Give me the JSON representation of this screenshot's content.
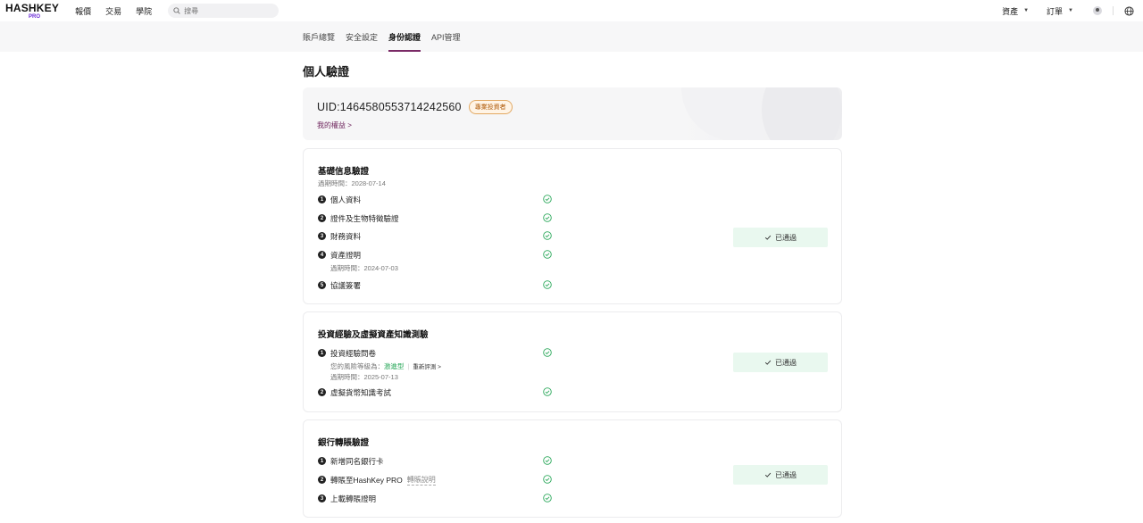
{
  "header": {
    "logo_main": "HASHKEY",
    "logo_sub": "PRO",
    "nav": [
      "報價",
      "交易",
      "學院"
    ],
    "search_placeholder": "搜尋",
    "right_menu": [
      "資產",
      "訂單"
    ]
  },
  "tabs": [
    {
      "label": "賬戶總覽",
      "active": false
    },
    {
      "label": "安全設定",
      "active": false
    },
    {
      "label": "身份認證",
      "active": true
    },
    {
      "label": "API管理",
      "active": false
    }
  ],
  "page_title": "個人驗證",
  "profile": {
    "uid": "UID:1464580553714242560",
    "badge": "專業投資者",
    "rights_link": "我的權益 >"
  },
  "sections": [
    {
      "title": "基礎信息驗證",
      "subtitle": "過期時間：2028-07-14",
      "status": "已通過",
      "steps": [
        {
          "num": "1",
          "label": "個人資料"
        },
        {
          "num": "2",
          "label": "證件及生物特徵驗證"
        },
        {
          "num": "3",
          "label": "財務資料"
        },
        {
          "num": "4",
          "label": "資產證明",
          "note": "過期時間：2024-07-03"
        },
        {
          "num": "5",
          "label": "協議簽署"
        }
      ]
    },
    {
      "title": "投資經驗及虛擬資產知識測驗",
      "status": "已通過",
      "steps": [
        {
          "num": "1",
          "label": "投資經驗問卷",
          "risk_prefix": "您的風險等級為：",
          "risk_value": "激進型",
          "reassess": "重新評測 >",
          "note": "過期時間：2025-07-13"
        },
        {
          "num": "2",
          "label": "虛擬貨幣知識考試"
        }
      ]
    },
    {
      "title": "銀行轉賬驗證",
      "status": "已通過",
      "steps": [
        {
          "num": "1",
          "label": "新增同名銀行卡"
        },
        {
          "num": "2",
          "label": "轉賬至HashKey PRO",
          "link": "轉賬說明"
        },
        {
          "num": "3",
          "label": "上載轉賬證明"
        }
      ]
    }
  ],
  "colors": {
    "accent": "#7a2a66",
    "success": "#2aa85a",
    "passed_bg": "#e9f8ef"
  }
}
